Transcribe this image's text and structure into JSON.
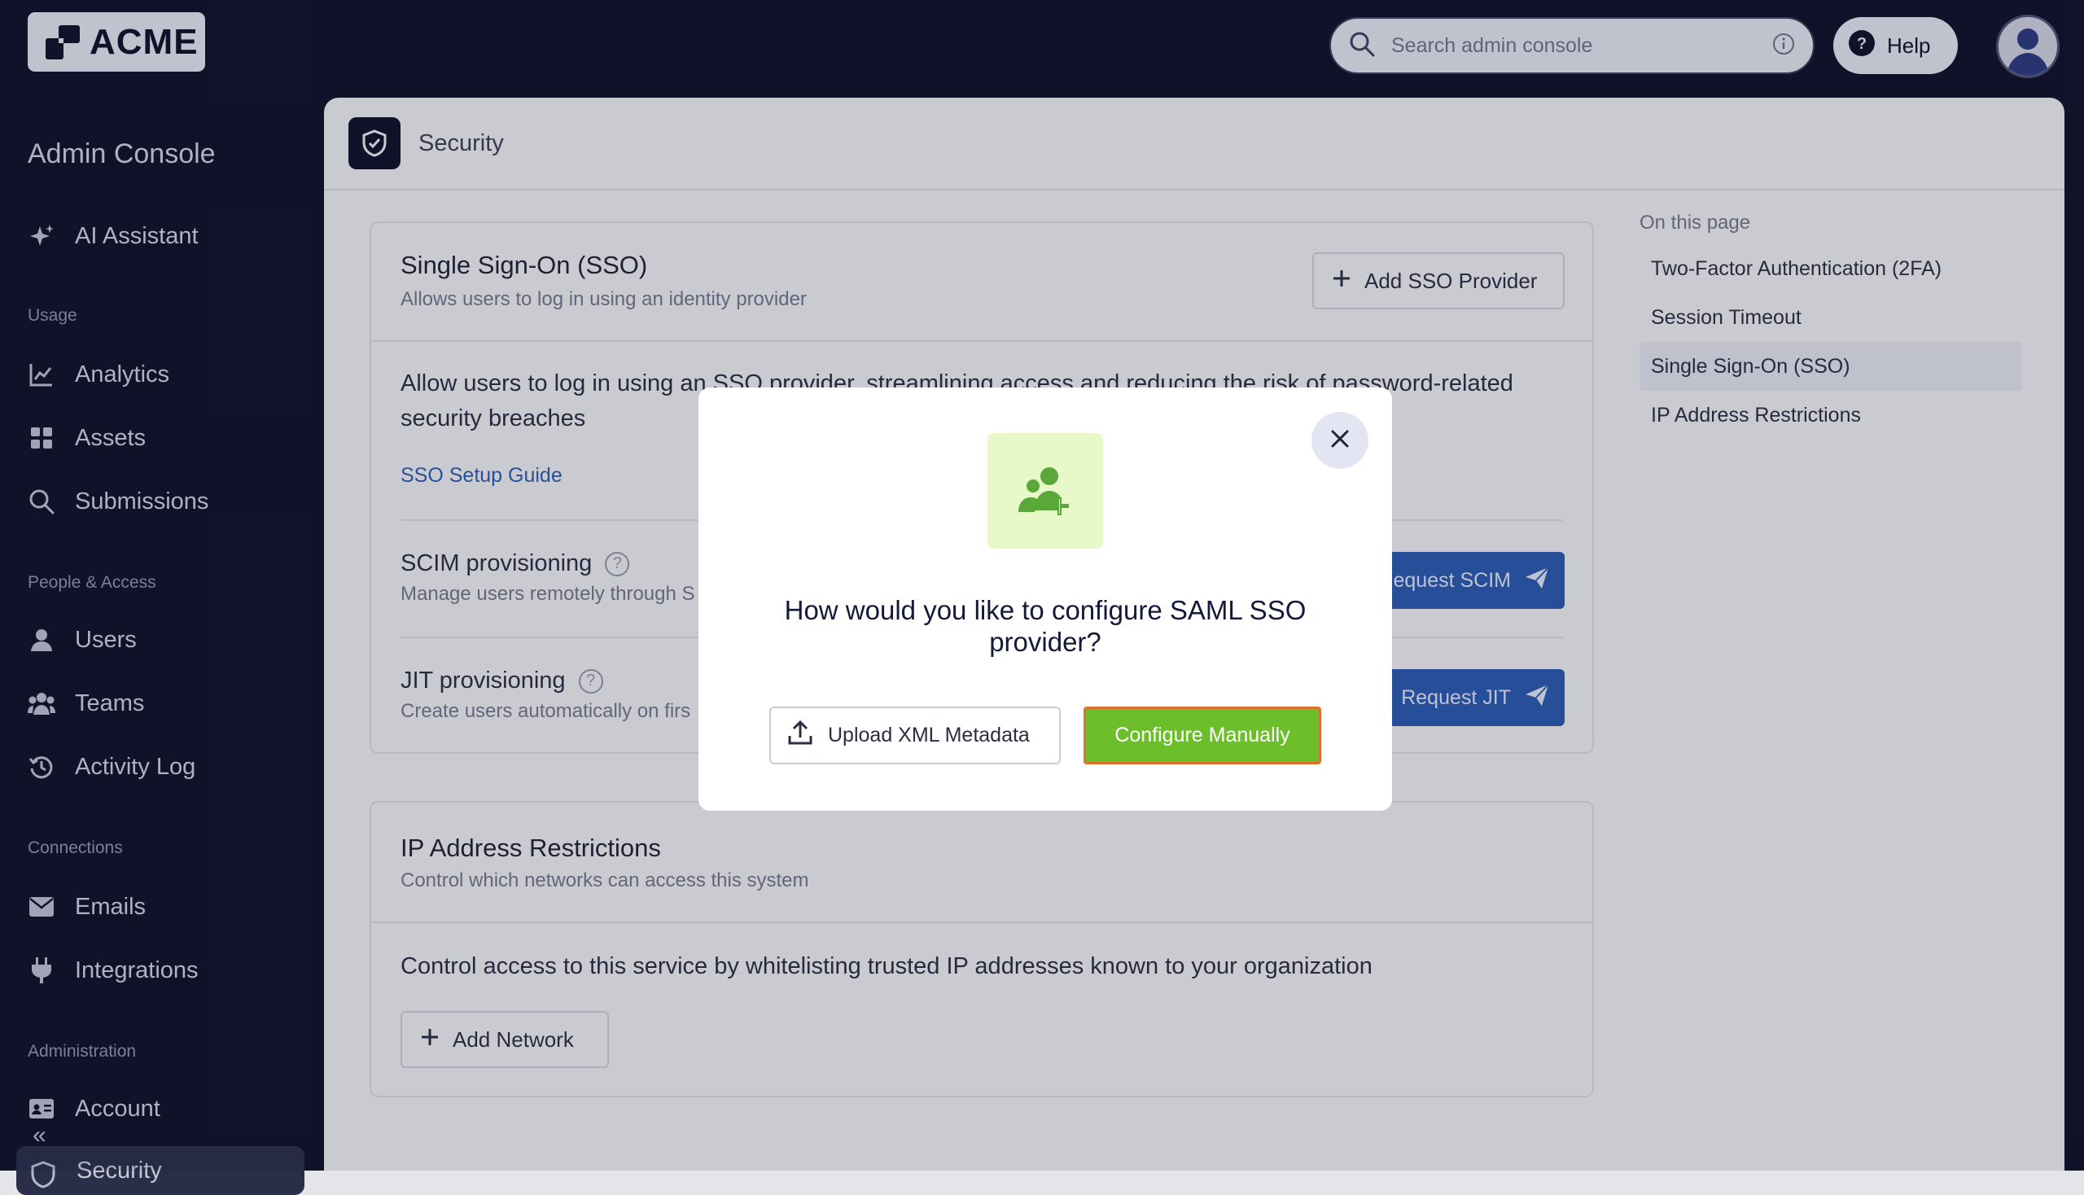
{
  "brand": {
    "logo_text": "ACME"
  },
  "topbar": {
    "search_placeholder": "Search admin console",
    "help_label": "Help"
  },
  "sidebar": {
    "title": "Admin Console",
    "ai_item": "AI Assistant",
    "sections": [
      {
        "label": "Usage",
        "items": [
          "Analytics",
          "Assets",
          "Submissions"
        ]
      },
      {
        "label": "People & Access",
        "items": [
          "Users",
          "Teams",
          "Activity Log"
        ]
      },
      {
        "label": "Connections",
        "items": [
          "Emails",
          "Integrations"
        ]
      },
      {
        "label": "Administration",
        "items": [
          "Account",
          "Security"
        ]
      }
    ],
    "collapse_glyph": "«"
  },
  "page": {
    "title": "Security",
    "sso": {
      "title": "Single Sign-On (SSO)",
      "subtitle": "Allows users to log in using an identity provider",
      "add_button": "Add SSO Provider",
      "description": "Allow users to log in using an SSO provider, streamlining access and reducing the risk of password-related security breaches",
      "guide_link": "SSO Setup Guide",
      "scim": {
        "title": "SCIM provisioning",
        "subtitle": "Manage users remotely through S",
        "button": "Request SCIM"
      },
      "jit": {
        "title": "JIT provisioning",
        "subtitle": "Create users automatically on firs",
        "button": "Request JIT"
      }
    },
    "ip": {
      "title": "IP Address Restrictions",
      "subtitle": "Control which networks can access this system",
      "description": "Control access to this service by whitelisting trusted IP addresses known to your organization",
      "add_button": "Add Network"
    },
    "on_this_page": {
      "title": "On this page",
      "items": [
        "Two-Factor Authentication (2FA)",
        "Session Timeout",
        "Single Sign-On (SSO)",
        "IP Address Restrictions"
      ],
      "active_index": 2
    }
  },
  "modal": {
    "question": "How would you like to configure SAML SSO provider?",
    "upload_button": "Upload XML Metadata",
    "configure_button": "Configure Manually"
  },
  "colors": {
    "chrome": "#10132b",
    "accent_blue": "#2b57a8",
    "accent_green": "#6cbf2a",
    "focus_ring": "#e0702c",
    "icon_bg": "#e7f9c9"
  }
}
